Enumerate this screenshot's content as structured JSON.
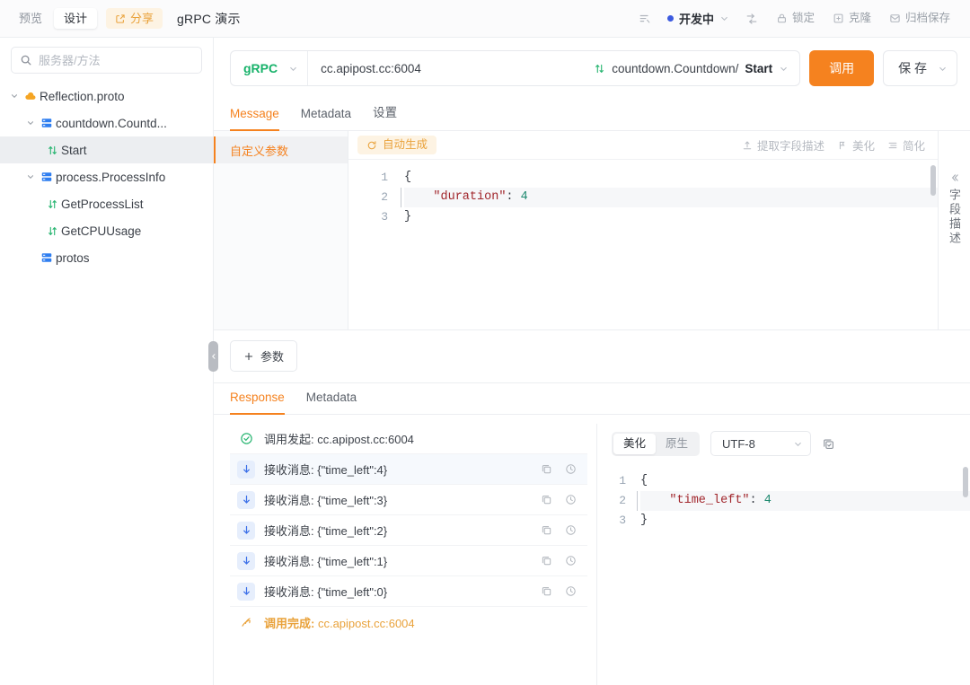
{
  "topbar": {
    "segments": [
      {
        "label": "预览",
        "active": false,
        "name": "tab-preview"
      },
      {
        "label": "设计",
        "active": true,
        "name": "tab-design"
      }
    ],
    "share_label": "分享",
    "share_icon": "share-square-icon",
    "doc_title": "gRPC 演示",
    "right": {
      "list_icon": "list-lines-icon",
      "status_label": "开发中",
      "status_color": "#3c5ae0",
      "status_chevron": "chevron-down-icon",
      "flow_icon": "flow-arrow-icon",
      "actions": [
        {
          "label": "锁定",
          "icon": "lock-icon",
          "name": "lock-button"
        },
        {
          "label": "克隆",
          "icon": "clone-icon",
          "name": "clone-button"
        },
        {
          "label": "归档保存",
          "icon": "archive-icon",
          "name": "archive-save-button"
        }
      ]
    }
  },
  "sidebar": {
    "search": {
      "placeholder": "服务器/方法",
      "value": "",
      "icon": "search-icon"
    },
    "tree": [
      {
        "label": "Reflection.proto",
        "level": 1,
        "icon": "proto-cloud-icon",
        "caret": "chevron-down-icon",
        "expanded": true,
        "selected": false
      },
      {
        "label": "countdown.Countd...",
        "level": 2,
        "icon": "service-icon",
        "caret": "chevron-down-icon",
        "expanded": true,
        "selected": false
      },
      {
        "label": "Start",
        "level": 3,
        "icon": "stream-arrows-icon",
        "caret": "",
        "expanded": false,
        "selected": true
      },
      {
        "label": "process.ProcessInfo",
        "level": 2,
        "icon": "service-icon",
        "caret": "chevron-down-icon",
        "expanded": true,
        "selected": false
      },
      {
        "label": "GetProcessList",
        "level": 3,
        "icon": "stream-arrows-icon",
        "caret": "",
        "expanded": false,
        "selected": false
      },
      {
        "label": "GetCPUUsage",
        "level": 3,
        "icon": "stream-arrows-icon",
        "caret": "",
        "expanded": false,
        "selected": false
      },
      {
        "label": "protos",
        "level": 2,
        "icon": "service-icon",
        "caret": "",
        "expanded": false,
        "selected": false
      }
    ],
    "collapse_handle_icon": "chevron-left-icon"
  },
  "request": {
    "protocol": "gRPC",
    "protocol_color": "#17b26a",
    "protocol_chevron": "chevron-down-icon",
    "url": "cc.apipost.cc:6004",
    "method_icon": "stream-arrows-icon",
    "method_service": "countdown.Countdown/",
    "method_name": "Start",
    "method_chevron": "chevron-down-icon",
    "invoke_label": "调用",
    "invoke_color": "#f5821f",
    "save_label": "保 存",
    "save_chevron": "chevron-down-icon"
  },
  "request_tabs": [
    {
      "label": "Message",
      "active": true,
      "name": "tab-message"
    },
    {
      "label": "Metadata",
      "active": false,
      "name": "tab-metadata"
    },
    {
      "label": "设置",
      "active": false,
      "name": "tab-settings"
    }
  ],
  "message_panel": {
    "param_side_item": "自定义参数",
    "auto_generate": {
      "label": "自动生成",
      "icon": "refresh-icon"
    },
    "tools": [
      {
        "label": "提取字段描述",
        "icon": "extract-icon",
        "name": "extract-field-desc-button"
      },
      {
        "label": "美化",
        "icon": "magic-wand-icon",
        "name": "beautify-button"
      },
      {
        "label": "简化",
        "icon": "minify-icon",
        "name": "minify-button"
      }
    ],
    "editor": {
      "lines": [
        {
          "no": "1",
          "tokens": [
            {
              "t": "{",
              "c": "pun"
            }
          ],
          "current": false
        },
        {
          "no": "2",
          "tokens": [
            {
              "t": "    ",
              "c": "pun"
            },
            {
              "t": "\"duration\"",
              "c": "str"
            },
            {
              "t": ": ",
              "c": "pun"
            },
            {
              "t": "4",
              "c": "num"
            }
          ],
          "current": true
        },
        {
          "no": "3",
          "tokens": [
            {
              "t": "}",
              "c": "pun"
            }
          ],
          "current": false
        }
      ]
    },
    "field_rail": {
      "collapse_icon": "double-chevron-left-icon",
      "label": "字段描述"
    },
    "add_param_label": "参数",
    "add_param_icon": "plus-icon"
  },
  "response_tabs": [
    {
      "label": "Response",
      "active": true,
      "name": "tab-response"
    },
    {
      "label": "Metadata",
      "active": false,
      "name": "tab-response-metadata"
    }
  ],
  "response_log": [
    {
      "icon": "check-circle-icon",
      "kind": "ok",
      "lead": "调用发起:",
      "detail": " cc.apipost.cc:6004",
      "actions": false,
      "highlight": false,
      "warn": false
    },
    {
      "icon": "arrow-down-icon",
      "kind": "recv",
      "lead": "接收消息:",
      "detail": " {\"time_left\":4}",
      "actions": true,
      "highlight": true,
      "warn": false
    },
    {
      "icon": "arrow-down-icon",
      "kind": "recv",
      "lead": "接收消息:",
      "detail": " {\"time_left\":3}",
      "actions": true,
      "highlight": false,
      "warn": false
    },
    {
      "icon": "arrow-down-icon",
      "kind": "recv",
      "lead": "接收消息:",
      "detail": " {\"time_left\":2}",
      "actions": true,
      "highlight": false,
      "warn": false
    },
    {
      "icon": "arrow-down-icon",
      "kind": "recv",
      "lead": "接收消息:",
      "detail": " {\"time_left\":1}",
      "actions": true,
      "highlight": false,
      "warn": false
    },
    {
      "icon": "arrow-down-icon",
      "kind": "recv",
      "lead": "接收消息:",
      "detail": " {\"time_left\":0}",
      "actions": true,
      "highlight": false,
      "warn": false
    },
    {
      "icon": "finish-icon",
      "kind": "done",
      "lead": "调用完成:",
      "detail": " cc.apipost.cc:6004",
      "actions": false,
      "highlight": false,
      "warn": true
    }
  ],
  "response_row_actions": [
    {
      "icon": "copy-icon",
      "name": "copy-message-button"
    },
    {
      "icon": "time-icon",
      "name": "timing-info-button"
    }
  ],
  "response_detail": {
    "view_modes": [
      {
        "label": "美化",
        "active": true,
        "name": "seg-beautify"
      },
      {
        "label": "原生",
        "active": false,
        "name": "seg-raw"
      }
    ],
    "encoding": {
      "value": "UTF-8",
      "chevron": "chevron-down-icon"
    },
    "copy_icon": "copy-icon",
    "editor": {
      "lines": [
        {
          "no": "1",
          "tokens": [
            {
              "t": "{",
              "c": "pun"
            }
          ],
          "current": false
        },
        {
          "no": "2",
          "tokens": [
            {
              "t": "    ",
              "c": "pun"
            },
            {
              "t": "\"time_left\"",
              "c": "str"
            },
            {
              "t": ": ",
              "c": "pun"
            },
            {
              "t": "4",
              "c": "num"
            }
          ],
          "current": true
        },
        {
          "no": "3",
          "tokens": [
            {
              "t": "}",
              "c": "pun"
            }
          ],
          "current": false
        }
      ]
    }
  }
}
